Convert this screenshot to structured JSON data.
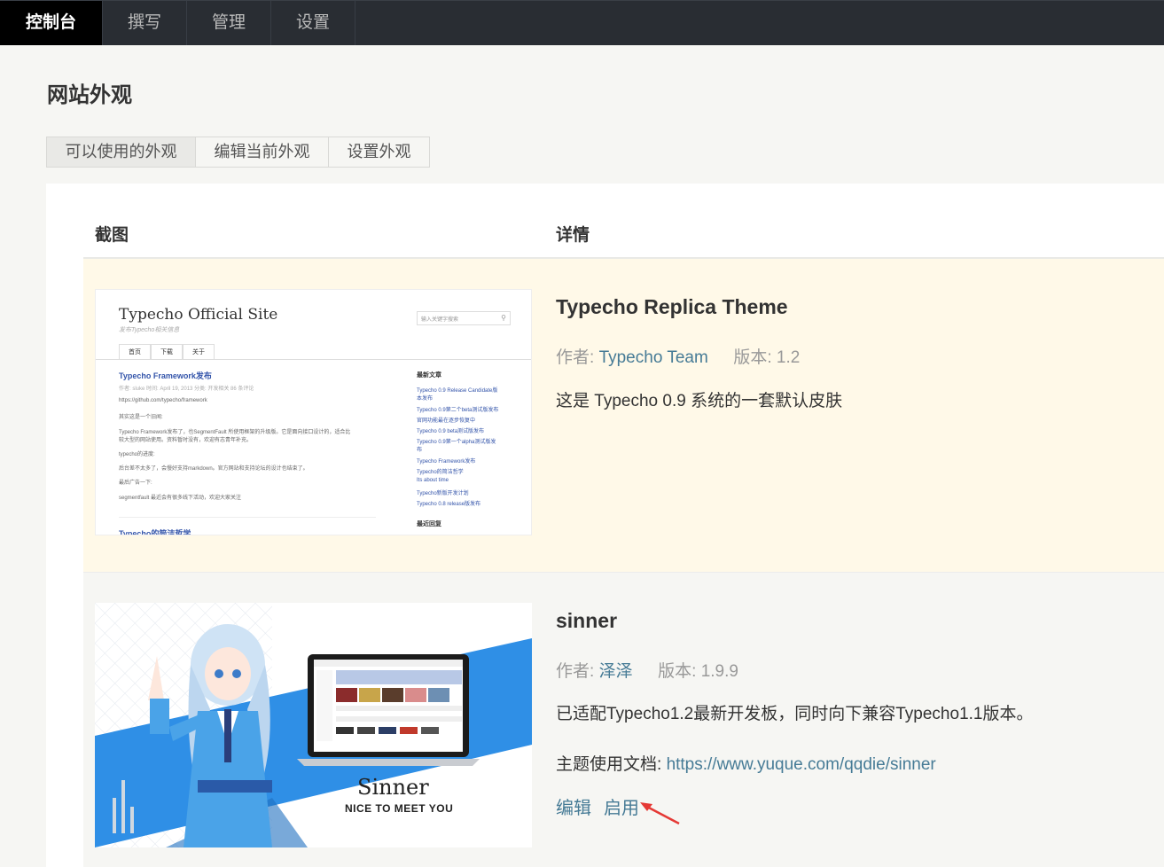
{
  "nav": {
    "items": [
      {
        "label": "控制台",
        "active": true
      },
      {
        "label": "撰写",
        "active": false
      },
      {
        "label": "管理",
        "active": false
      },
      {
        "label": "设置",
        "active": false
      }
    ]
  },
  "page": {
    "title": "网站外观"
  },
  "tabs": [
    {
      "label": "可以使用的外观",
      "active": true
    },
    {
      "label": "编辑当前外观",
      "active": false
    },
    {
      "label": "设置外观",
      "active": false
    }
  ],
  "table": {
    "headers": {
      "screenshot": "截图",
      "details": "详情"
    }
  },
  "themes": [
    {
      "name": "Typecho Replica Theme",
      "author_label": "作者: ",
      "author": "Typecho Team",
      "version_label": "版本: ",
      "version": "1.2",
      "description": "这是 Typecho 0.9 系统的一套默认皮肤",
      "current": true,
      "preview": {
        "site_title": "Typecho Official Site",
        "site_subtitle": "发布Typecho相关信息",
        "search_placeholder": "输入关键字搜索",
        "nav": [
          "首页",
          "下载",
          "关于"
        ],
        "post_title": "Typecho Framework发布",
        "post_meta": "作者: sluke  时间: April 19, 2013  分类: 开发相关  86 条评论",
        "post_lines": [
          "https://github.com/typecho/framework",
          "其实这是一个旧闻:",
          "Typecho Framework发布了，也SegmentFault 所使用框架的升级版。它是面向接口设计的，适合比",
          "较大型的网站使用。资料暂时没有，欢迎有志青年补充。",
          "typecho的进度:",
          "后台差不太多了，会慢好支持markdown。官方网站和支持论坛的设计也结束了。",
          "最后广告一下:",
          "segmentfault 最近会有很多线下活动，欢迎大家关注"
        ],
        "next_post": "Typecho的简洁哲学",
        "sidebar_heading": "最新文章",
        "sidebar_items": [
          "Typecho 0.9 Release Candidate版",
          "本发布",
          "Typecho 0.9第二个beta测试版发布",
          "官网功能最在逐步恢复中",
          "Typecho 0.9 beta测试版发布",
          "Typecho 0.9第一个alpha测试版发",
          "布",
          "Typecho Framework发布",
          "Typecho的简洁哲学",
          "Its about time",
          "Typecho新版开发计划",
          "Typecho 0.8 release版发布"
        ],
        "sidebar_heading2": "最近回复"
      }
    },
    {
      "name": "sinner",
      "author_label": "作者: ",
      "author": "泽泽",
      "version_label": "版本: ",
      "version": "1.9.9",
      "description": "已适配Typecho1.2最新开发板，同时向下兼容Typecho1.1版本。",
      "doc_label": "主题使用文档: ",
      "doc_url": "https://www.yuque.com/qqdie/sinner",
      "actions": {
        "edit": "编辑",
        "activate": "启用"
      },
      "preview": {
        "title": "Sinner",
        "subtitle": "NICE TO MEET YOU"
      }
    }
  ],
  "colors": {
    "nav_bg": "#292d33",
    "link": "#467b96",
    "current_row": "#fff9e8",
    "annotation_arrow": "#e53935",
    "sinner_blue": "#2f8fe6"
  }
}
